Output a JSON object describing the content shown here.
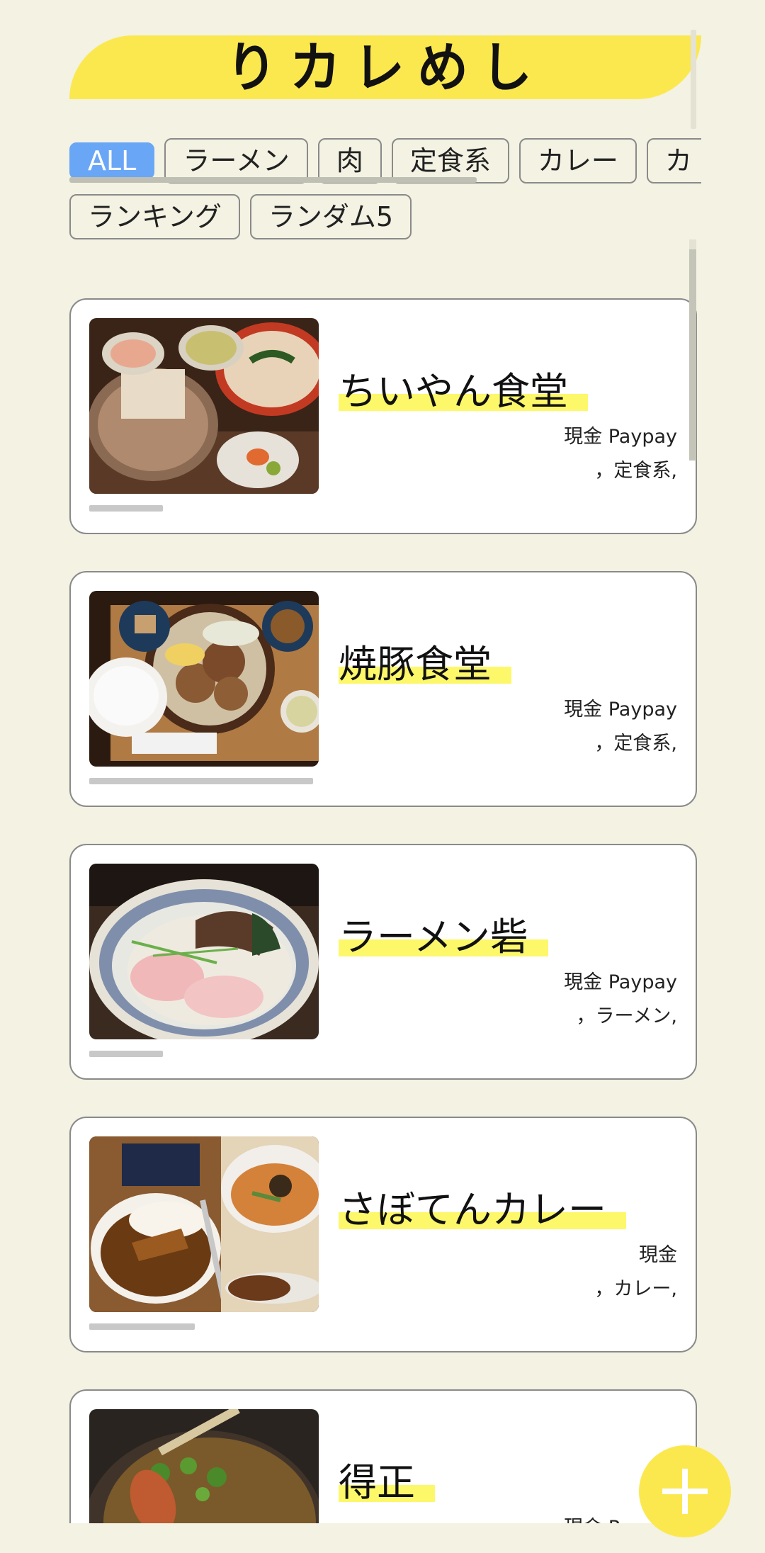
{
  "app": {
    "title": "りカレめし"
  },
  "filters": [
    {
      "label": "ALL",
      "active": true
    },
    {
      "label": "ラーメン",
      "active": false
    },
    {
      "label": "肉",
      "active": false
    },
    {
      "label": "定食系",
      "active": false
    },
    {
      "label": "カレー",
      "active": false
    },
    {
      "label": "カ",
      "active": false
    }
  ],
  "filters_row2": [
    {
      "label": "ランキング"
    },
    {
      "label": "ランダム5"
    }
  ],
  "restaurants": [
    {
      "name": "ちいやん食堂",
      "payment": "現金 Paypay",
      "tags": "，定食系,",
      "photo_icon": "teishoku-photo",
      "rating": 0.33
    },
    {
      "name": "焼豚食堂",
      "payment": "現金 Paypay",
      "tags": "，定食系,",
      "photo_icon": "yakibuta-photo",
      "rating": 1.0
    },
    {
      "name": "ラーメン砦",
      "payment": "現金 Paypay",
      "tags": "，ラーメン,",
      "photo_icon": "ramen-photo",
      "rating": 0.33
    },
    {
      "name": "さぼてんカレー",
      "payment": "現金",
      "tags": "，カレー,",
      "photo_icon": "curry-photo",
      "rating": 0.47
    },
    {
      "name": "得正",
      "payment": "現金 Paypay",
      "tags": "",
      "photo_icon": "curry-udon-photo",
      "rating": 0
    }
  ],
  "fab": {
    "icon": "plus-icon"
  },
  "colors": {
    "background": "#f3f2e3",
    "accent_yellow": "#fbe84f",
    "highlight_yellow": "#fdf86a",
    "chip_active": "#6aa6f6"
  }
}
